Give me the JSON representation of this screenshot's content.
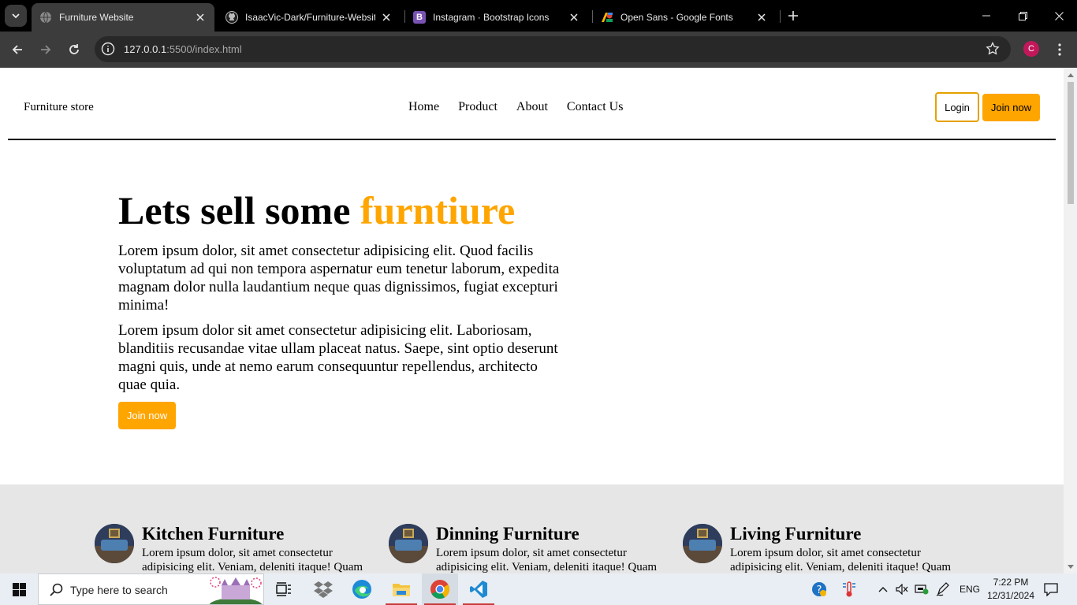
{
  "browser": {
    "tabs": [
      {
        "title": "Furniture Website",
        "active": true,
        "favicon": "globe-icon"
      },
      {
        "title": "IsaacVic-Dark/Furniture-Website",
        "active": false,
        "favicon": "github-icon"
      },
      {
        "title": "Instagram · Bootstrap Icons",
        "active": false,
        "favicon": "bootstrap-icon"
      },
      {
        "title": "Open Sans - Google Fonts",
        "active": false,
        "favicon": "google-fonts-icon"
      }
    ],
    "url_host": "127.0.0.1",
    "url_path": ":5500/index.html",
    "profile_initial": "C"
  },
  "site": {
    "brand": "Furniture store",
    "nav": [
      "Home",
      "Product",
      "About",
      "Contact Us"
    ],
    "login_label": "Login",
    "join_label": "Join now",
    "hero": {
      "title_main": "Lets sell some ",
      "title_accent": "furntiure",
      "p1": "Lorem ipsum dolor, sit amet consectetur adipisicing elit. Quod facilis voluptatum ad qui non tempora aspernatur eum tenetur laborum, expedita magnam dolor nulla laudantium neque quas dignissimos, fugiat excepturi minima!",
      "p2": "Lorem ipsum dolor sit amet consectetur adipisicing elit. Laboriosam, blanditiis recusandae vitae ullam placeat natus. Saepe, sint optio deserunt magni quis, unde at nemo earum consequuntur repellendus, architecto quae quia.",
      "cta": "Join now"
    },
    "features": [
      {
        "title": "Kitchen Furniture",
        "text": "Lorem ipsum dolor, sit amet consectetur adipisicing elit. Veniam, deleniti itaque! Quam"
      },
      {
        "title": "Dinning Furniture",
        "text": "Lorem ipsum dolor, sit amet consectetur adipisicing elit. Veniam, deleniti itaque! Quam"
      },
      {
        "title": "Living Furniture",
        "text": "Lorem ipsum dolor, sit amet consectetur adipisicing elit. Veniam, deleniti itaque! Quam"
      }
    ]
  },
  "taskbar": {
    "search_placeholder": "Type here to search",
    "language": "ENG",
    "time": "7:22 PM",
    "date": "12/31/2024"
  },
  "colors": {
    "accent": "#ffa500",
    "features_bg": "#e6e6e6"
  }
}
